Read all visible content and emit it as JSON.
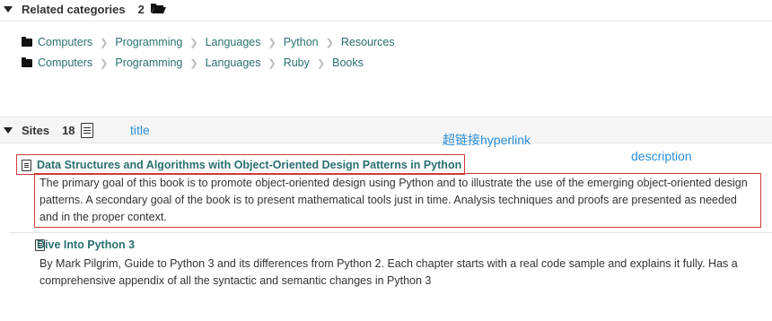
{
  "related": {
    "heading": "Related categories",
    "count": "2",
    "paths": [
      [
        "Computers",
        "Programming",
        "Languages",
        "Python",
        "Resources"
      ],
      [
        "Computers",
        "Programming",
        "Languages",
        "Ruby",
        "Books"
      ]
    ]
  },
  "sites": {
    "heading": "Sites",
    "count": "18",
    "items": [
      {
        "title": "Data Structures and Algorithms with Object-Oriented Design Patterns in Python",
        "description": "The primary goal of this book is to promote object-oriented design using Python and to illustrate the use of the emerging object-oriented design patterns. A secondary goal of the book is to present mathematical tools just in time. Analysis techniques and proofs are presented as needed and in the proper context."
      },
      {
        "title": "Dive Into Python 3",
        "description": "By Mark Pilgrim, Guide to Python 3 and its differences from Python 2. Each chapter starts with a real code sample and explains it fully. Has a comprehensive appendix of all the syntactic and semantic changes in Python 3"
      }
    ]
  },
  "annotations": {
    "title": "title",
    "hyperlink": "超链接hyperlink",
    "description": "description",
    "color": "#2b8fd6",
    "box_color": "#d03a3a"
  },
  "colors": {
    "link": "#2a6f6f",
    "header_bg": "#f5f5f5"
  }
}
